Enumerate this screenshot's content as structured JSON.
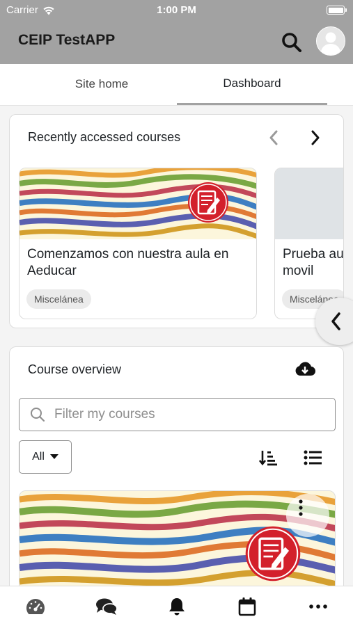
{
  "status_bar": {
    "carrier": "Carrier",
    "time": "1:00 PM"
  },
  "header": {
    "title": "CEIP TestAPP",
    "search_icon": "search-icon",
    "avatar_icon": "user-avatar-icon"
  },
  "tabs": [
    {
      "label": "Site home",
      "active": false
    },
    {
      "label": "Dashboard",
      "active": true
    }
  ],
  "recent": {
    "heading": "Recently accessed courses",
    "courses": [
      {
        "title": "Comenzamos con nuestra aula en Aeducar",
        "category": "Miscelánea"
      },
      {
        "title": "Prueba aula movil",
        "category": "Miscelánea"
      }
    ]
  },
  "overview": {
    "heading": "Course overview",
    "filter_placeholder": "Filter my courses",
    "select_value": "All"
  },
  "bottom_nav": [
    "dashboard-icon",
    "messages-icon",
    "notifications-icon",
    "calendar-icon",
    "more-icon"
  ],
  "colors": {
    "header_bg": "#a2a2a2",
    "accent_red": "#d3202b",
    "chip_bg": "#ebebeb"
  }
}
